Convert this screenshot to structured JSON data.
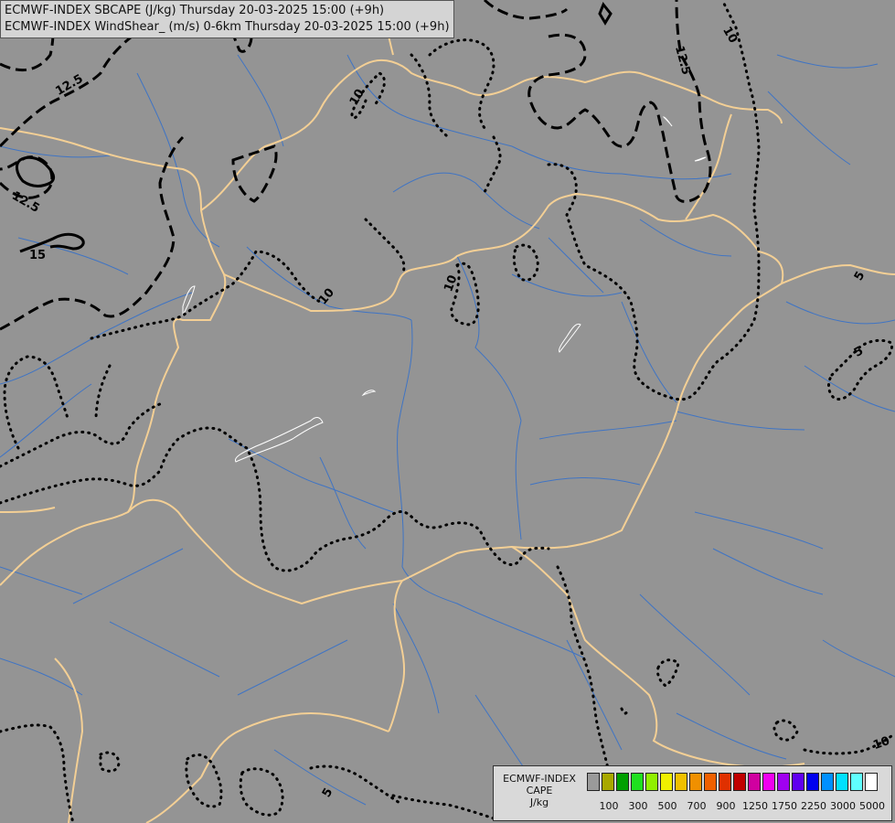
{
  "header": {
    "line1": "ECMWF-INDEX SBCAPE (J/kg) Thursday 20-03-2025 15:00 (+9h)",
    "line2": "ECMWF-INDEX WindShear_ (m/s) 0-6km Thursday 20-03-2025 15:00 (+9h)"
  },
  "map": {
    "background_color": "#949494",
    "border_color": "#f3cf95",
    "river_color": "#3f74c4",
    "contour_labels": [
      "10",
      "12.5",
      "12.5",
      "12.5",
      "15",
      "10",
      "10",
      "10",
      "5",
      "5",
      "10",
      "5"
    ]
  },
  "legend": {
    "line1": "ECMWF-INDEX",
    "line2": "CAPE",
    "line3": "J/kg",
    "colors": [
      "#9a9a9a",
      "#a8a800",
      "#00a000",
      "#20e020",
      "#90f000",
      "#f0f000",
      "#f0c000",
      "#f09000",
      "#f06000",
      "#e03000",
      "#c00000",
      "#d000a0",
      "#f000f0",
      "#a000f0",
      "#6000f0",
      "#0000f0",
      "#0090ff",
      "#00e0ff",
      "#60ffff",
      "#ffffff"
    ],
    "ticks": [
      "100",
      "300",
      "500",
      "700",
      "900",
      "1250",
      "1750",
      "2250",
      "3000",
      "5000"
    ]
  }
}
